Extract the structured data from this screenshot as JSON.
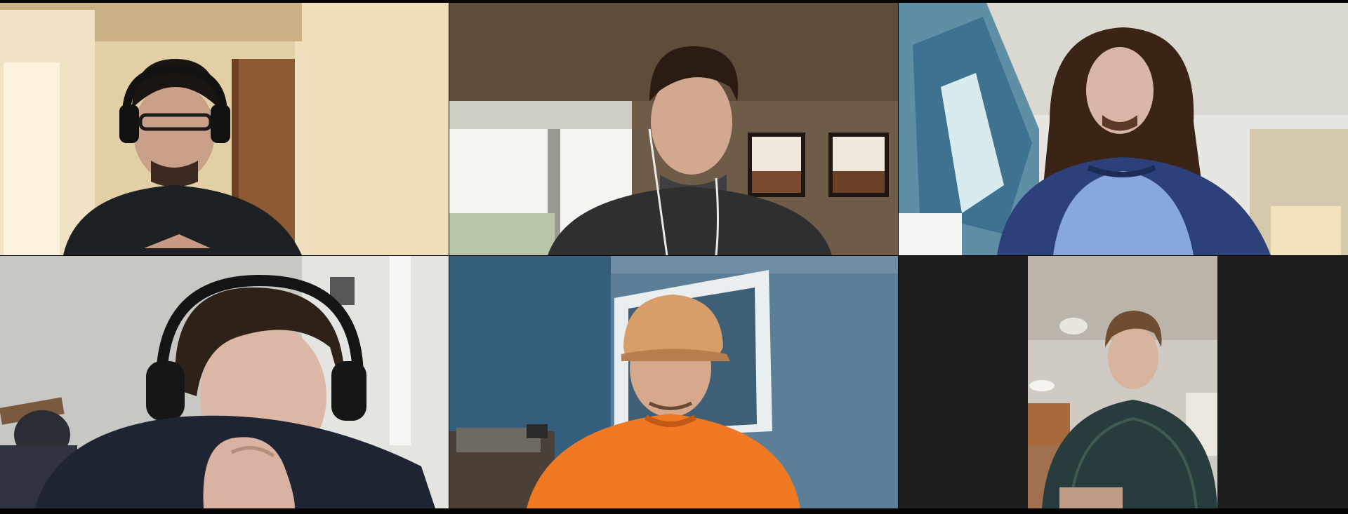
{
  "meeting": {
    "view": "gallery",
    "participants": [
      {
        "tile": 1,
        "video": "on"
      },
      {
        "tile": 2,
        "video": "on"
      },
      {
        "tile": 3,
        "video": "on"
      },
      {
        "tile": 4,
        "video": "on"
      },
      {
        "tile": 5,
        "video": "on"
      },
      {
        "tile": 6,
        "video": "on"
      }
    ]
  },
  "colors": {
    "background": "#050505",
    "empty_tile": "#1e1e1e"
  }
}
